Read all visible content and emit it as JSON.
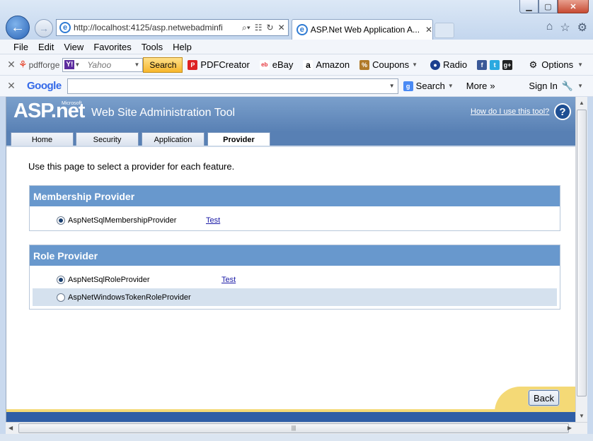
{
  "browser": {
    "window_buttons": {
      "minimize": "▁",
      "maximize": "▢",
      "close": "✕"
    },
    "address": "http://localhost:4125/asp.netwebadminfi",
    "tab_title": "ASP.Net Web Application A...",
    "tab_close": "✕",
    "menu": [
      "File",
      "Edit",
      "View",
      "Favorites",
      "Tools",
      "Help"
    ],
    "toolbar1": {
      "pdfforge": "pdfforge",
      "yahoo_placeholder": "Yahoo",
      "yahoo_logo": "Y!",
      "search_button": "Search",
      "items": [
        "PDFCreator",
        "eBay",
        "Amazon",
        "Coupons",
        "Radio"
      ],
      "options": "Options"
    },
    "toolbar2": {
      "google": "Google",
      "search": "Search",
      "more": "More",
      "sign_in": "Sign In"
    }
  },
  "wsat": {
    "logo": "ASP.net",
    "logo_sup": "Microsoft",
    "title": "Web Site Administration Tool",
    "help_link": "How do I use this tool?",
    "help_icon": "?",
    "tabs": [
      "Home",
      "Security",
      "Application",
      "Provider"
    ],
    "active_tab": "Provider",
    "intro": "Use this page to select a provider for each feature.",
    "membership": {
      "header": "Membership Provider",
      "providers": [
        {
          "name": "AspNetSqlMembershipProvider",
          "selected": true,
          "test": "Test"
        }
      ]
    },
    "role": {
      "header": "Role Provider",
      "providers": [
        {
          "name": "AspNetSqlRoleProvider",
          "selected": true,
          "test": "Test"
        },
        {
          "name": "AspNetWindowsTokenRoleProvider",
          "selected": false,
          "test": ""
        }
      ]
    },
    "back_button": "Back"
  },
  "colors": {
    "header_blue": "#5880b4",
    "section_header": "#6898cd",
    "alt_row": "#d5e1ee",
    "footer_yellow": "#f4d976",
    "footer_blue": "#2f5ea6"
  }
}
